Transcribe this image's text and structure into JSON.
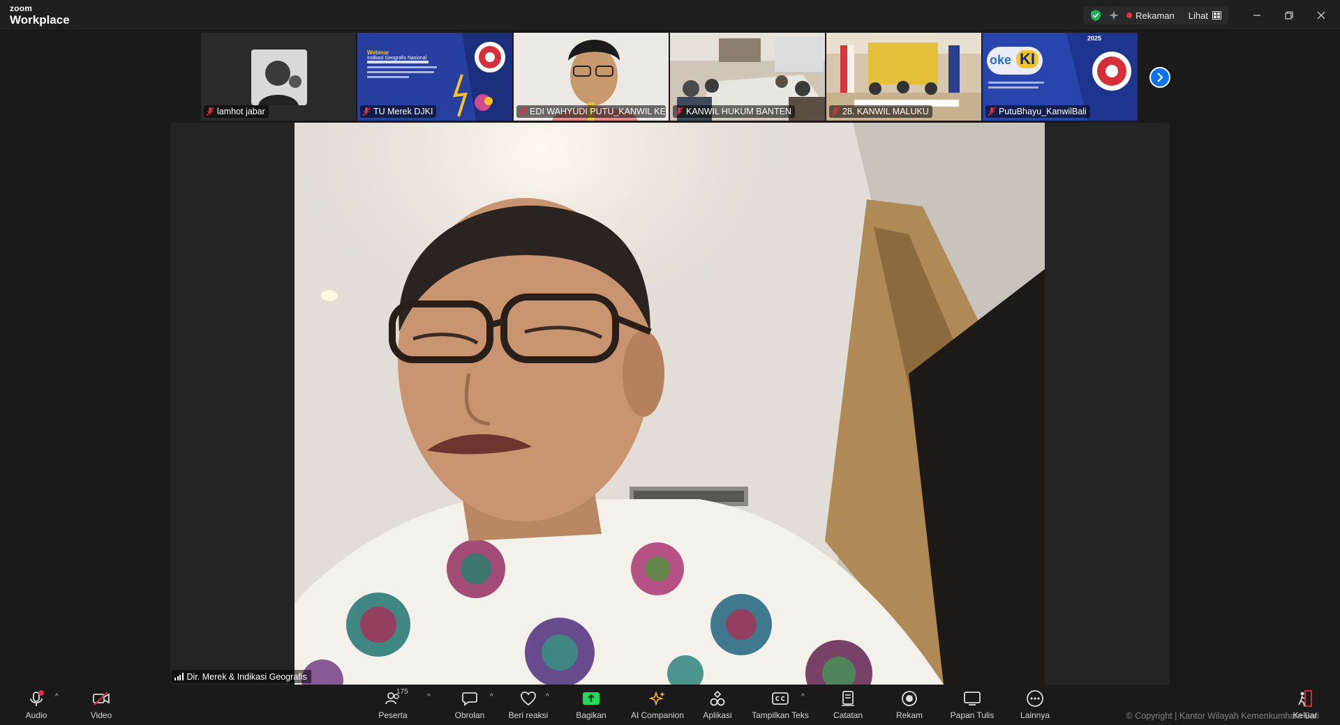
{
  "titlebar": {
    "brand_small": "zoom",
    "brand_large": "Workplace",
    "recording_label": "Rekaman",
    "view_label": "Lihat"
  },
  "gallery": {
    "tiles": [
      {
        "name": "lamhot jabar"
      },
      {
        "name": "TU Merek DJKI",
        "slide_title": "Webinar",
        "slide_subtitle": "Indikasi Geografis Nasional"
      },
      {
        "name": "EDI WAHYUDI PUTU_KANWIL KE..."
      },
      {
        "name": "KANWIL HUKUM BANTEN"
      },
      {
        "name": "28. KANWIL MALUKU"
      },
      {
        "name": "PutuBhayu_KanwilBali",
        "logo_text_1": "oke",
        "logo_text_2": "KI",
        "year": "2025"
      }
    ]
  },
  "main_video": {
    "speaker_name": "Dir. Merek & Indikasi Geografis"
  },
  "toolbar": {
    "audio": "Audio",
    "video": "Video",
    "participants": "Peserta",
    "participant_count": "175",
    "chat": "Obrolan",
    "react": "Beri reaksi",
    "share": "Bagikan",
    "ai": "AI Companion",
    "apps": "Aplikasi",
    "captions": "Tampilkan Teks",
    "notes": "Catatan",
    "record": "Rekam",
    "whiteboard": "Papan Tulis",
    "more": "Lainnya",
    "leave": "Keluar"
  },
  "watermark": {
    "text": "© Copyright | Kantor Wilayah Kemenkumham Bali"
  },
  "colors": {
    "accent": "#0e72ed",
    "record_red": "#e02f44",
    "share_green": "#23d959",
    "shield_green": "#1fb35a"
  }
}
